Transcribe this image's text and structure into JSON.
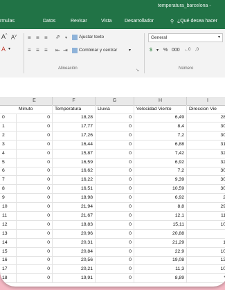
{
  "window": {
    "title": "temperatura_barcelona -"
  },
  "menu": {
    "items": [
      "rmulas",
      "Datos",
      "Revisar",
      "Vista",
      "Desarrollador"
    ],
    "tell_me": "¿Qué desea hacer"
  },
  "ribbon": {
    "wrap_text": "Ajustar texto",
    "merge_center": "Combinar y centrar",
    "number_format": "General",
    "alignment_label": "Alineación",
    "number_label": "Número",
    "font_size_up": "A",
    "font_size_down": "A"
  },
  "sheet": {
    "column_letters": [
      "E",
      "F",
      "G",
      "H",
      "I"
    ],
    "headers": [
      "Minuto",
      "Temperatura",
      "Lluvia",
      "Velocidad Viento",
      "Direccion Vie"
    ],
    "rows": [
      {
        "min": "0",
        "zero": "0",
        "temp": "18,28",
        "rain": "0",
        "wind": "6,49",
        "dir": "28"
      },
      {
        "min": "1",
        "zero": "0",
        "temp": "17,77",
        "rain": "0",
        "wind": "8,4",
        "dir": "30"
      },
      {
        "min": "2",
        "zero": "0",
        "temp": "17,26",
        "rain": "0",
        "wind": "7,2",
        "dir": "30"
      },
      {
        "min": "3",
        "zero": "0",
        "temp": "16,44",
        "rain": "0",
        "wind": "6,88",
        "dir": "31"
      },
      {
        "min": "4",
        "zero": "0",
        "temp": "15,87",
        "rain": "0",
        "wind": "7,42",
        "dir": "32"
      },
      {
        "min": "5",
        "zero": "0",
        "temp": "16,59",
        "rain": "0",
        "wind": "6,92",
        "dir": "32"
      },
      {
        "min": "6",
        "zero": "0",
        "temp": "16,62",
        "rain": "0",
        "wind": "7,2",
        "dir": "30"
      },
      {
        "min": "7",
        "zero": "0",
        "temp": "16,22",
        "rain": "0",
        "wind": "9,39",
        "dir": "30"
      },
      {
        "min": "8",
        "zero": "0",
        "temp": "16,51",
        "rain": "0",
        "wind": "10,59",
        "dir": "30"
      },
      {
        "min": "9",
        "zero": "0",
        "temp": "18,98",
        "rain": "0",
        "wind": "6,92",
        "dir": "2"
      },
      {
        "min": "10",
        "zero": "0",
        "temp": "21,94",
        "rain": "0",
        "wind": "8,8",
        "dir": "29"
      },
      {
        "min": "11",
        "zero": "0",
        "temp": "21,67",
        "rain": "0",
        "wind": "12,1",
        "dir": "11"
      },
      {
        "min": "12",
        "zero": "0",
        "temp": "18,83",
        "rain": "0",
        "wind": "15,11",
        "dir": "10"
      },
      {
        "min": "13",
        "zero": "0",
        "temp": "20,96",
        "rain": "0",
        "wind": "20,88",
        "dir": ""
      },
      {
        "min": "14",
        "zero": "0",
        "temp": "20,31",
        "rain": "0",
        "wind": "21,29",
        "dir": "1"
      },
      {
        "min": "15",
        "zero": "0",
        "temp": "20,84",
        "rain": "0",
        "wind": "22,9",
        "dir": "10"
      },
      {
        "min": "16",
        "zero": "0",
        "temp": "20,56",
        "rain": "0",
        "wind": "19,08",
        "dir": "12"
      },
      {
        "min": "17",
        "zero": "0",
        "temp": "20,21",
        "rain": "0",
        "wind": "11,3",
        "dir": "10"
      },
      {
        "min": "18",
        "zero": "0",
        "temp": "19,91",
        "rain": "0",
        "wind": "8,89",
        "dir": "*"
      }
    ]
  },
  "colors": {
    "excel_green": "#217346",
    "background_pink": "#f4b8c4"
  }
}
